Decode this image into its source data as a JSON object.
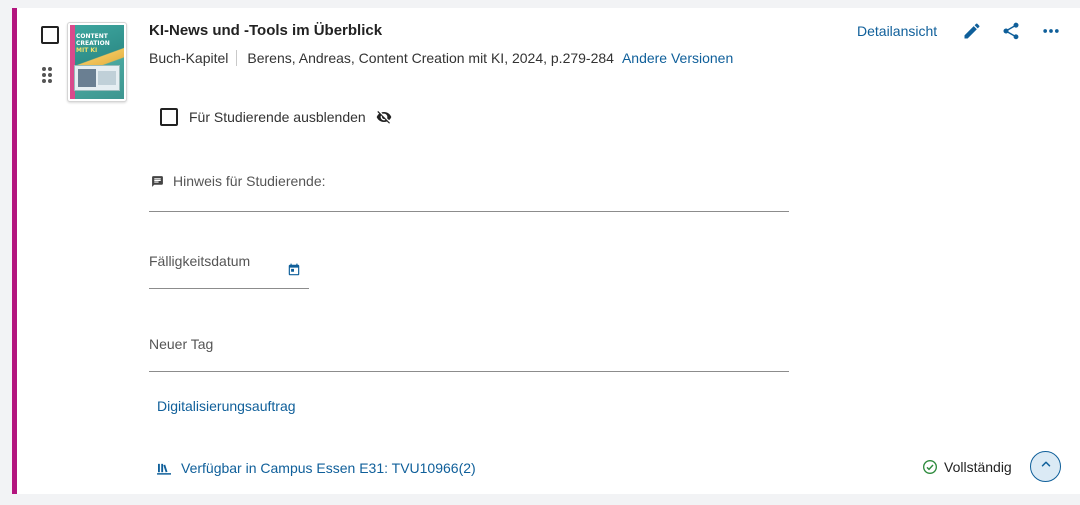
{
  "item": {
    "title": "KI-News und -Tools im Überblick",
    "type": "Buch-Kapitel",
    "citation": "Berens, Andreas, Content Creation mit KI, 2024, p.279-284",
    "other_versions": "Andere Versionen",
    "cover_text": [
      "CONTENT",
      "CREATION",
      "MIT KI"
    ]
  },
  "actions": {
    "detail_view": "Detailansicht",
    "edit_icon": "pencil-icon",
    "share_icon": "share-icon",
    "more_icon": "more-horizontal-icon"
  },
  "hide_for_students": {
    "label": "Für Studierende ausblenden",
    "checked": false,
    "icon": "eye-off-icon"
  },
  "fields": {
    "note_label": "Hinweis für Studierende:",
    "due_date_label": "Fälligkeitsdatum",
    "new_tag_label": "Neuer Tag"
  },
  "links": {
    "digitization": "Digitalisierungsauftrag",
    "availability": "Verfügbar in Campus Essen E31: TVU10966(2)"
  },
  "status": {
    "text": "Vollständig",
    "icon": "check-circle-icon"
  },
  "colors": {
    "accent_bar": "#b3157e",
    "link": "#0f5f9a",
    "status_ok": "#2e8b3e"
  }
}
